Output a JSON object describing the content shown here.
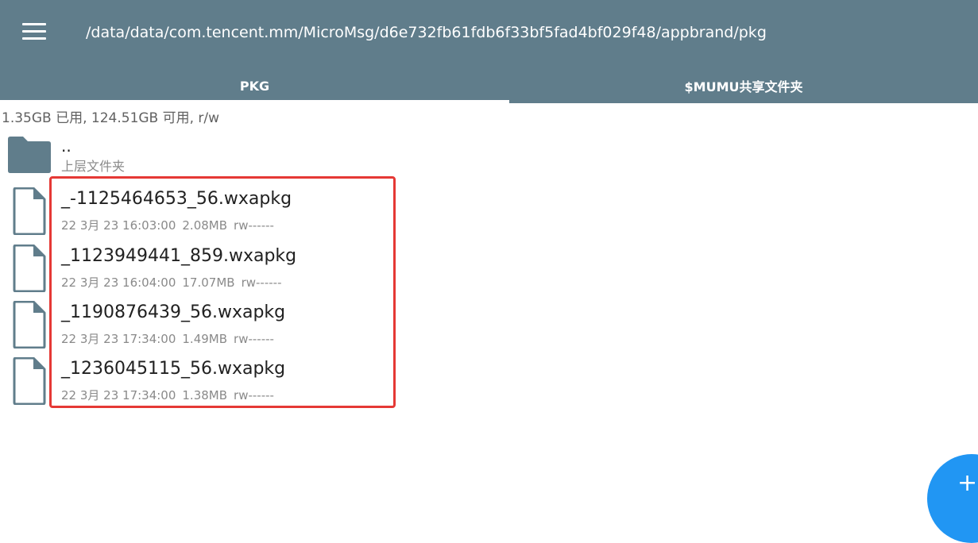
{
  "toolbar": {
    "menu_icon": "hamburger-menu-icon",
    "path": "/data/data/com.tencent.mm/MicroMsg/d6e732fb61fdb6f33bf5fad4bf029f48/appbrand/pkg",
    "background_color": "#607d8b"
  },
  "tabs": [
    {
      "label": "PKG",
      "active": true
    },
    {
      "label": "$MUMU共享文件夹",
      "active": false
    }
  ],
  "storage_info": "1.35GB 已用, 124.51GB 可用, r/w",
  "parent_folder": {
    "name": "..",
    "subtitle": "上层文件夹",
    "icon": "folder-icon"
  },
  "files": [
    {
      "name": "_-1125464653_56.wxapkg",
      "date": "22 3月 23 16:03:00",
      "size": "2.08MB",
      "perms": "rw------",
      "icon": "file-icon"
    },
    {
      "name": "_1123949441_859.wxapkg",
      "date": "22 3月 23 16:04:00",
      "size": "17.07MB",
      "perms": "rw------",
      "icon": "file-icon"
    },
    {
      "name": "_1190876439_56.wxapkg",
      "date": "22 3月 23 17:34:00",
      "size": "1.49MB",
      "perms": "rw------",
      "icon": "file-icon"
    },
    {
      "name": "_1236045115_56.wxapkg",
      "date": "22 3月 23 17:34:00",
      "size": "1.38MB",
      "perms": "rw------",
      "icon": "file-icon"
    }
  ],
  "fab": {
    "icon": "plus-icon",
    "label": "+",
    "color": "#2196f3"
  },
  "highlight_color": "#e53935"
}
